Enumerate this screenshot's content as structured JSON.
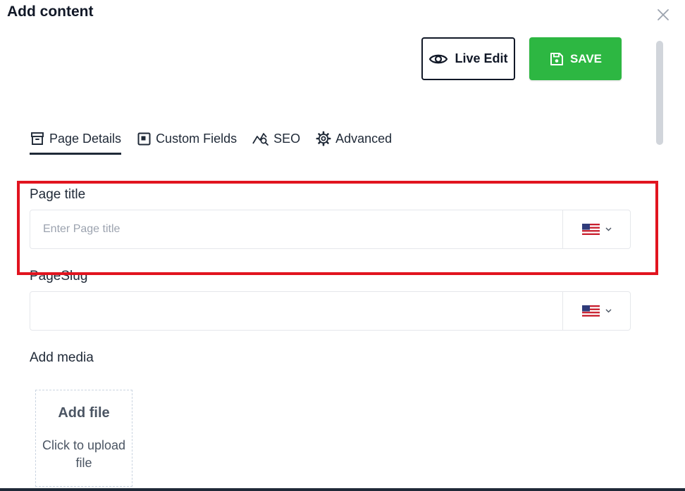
{
  "dialog": {
    "title": "Add content"
  },
  "toolbar": {
    "live_edit_label": "Live Edit",
    "save_label": "SAVE",
    "save_color": "#2db742"
  },
  "tabs": [
    {
      "label": "Page Details",
      "icon": "archive-icon",
      "active": true
    },
    {
      "label": "Custom Fields",
      "icon": "square-icon",
      "active": false
    },
    {
      "label": "SEO",
      "icon": "seo-chart-icon",
      "active": false
    },
    {
      "label": "Advanced",
      "icon": "gear-icon",
      "active": false
    }
  ],
  "fields": {
    "page_title": {
      "label": "Page title",
      "placeholder": "Enter Page title",
      "value": "",
      "language": "us-flag-icon"
    },
    "page_slug": {
      "label": "PageSlug",
      "placeholder": "",
      "value": "",
      "language": "us-flag-icon"
    }
  },
  "media": {
    "label": "Add media",
    "add_file_title": "Add file",
    "add_file_hint": "Click to upload file"
  },
  "highlight_color": "#e1141f"
}
